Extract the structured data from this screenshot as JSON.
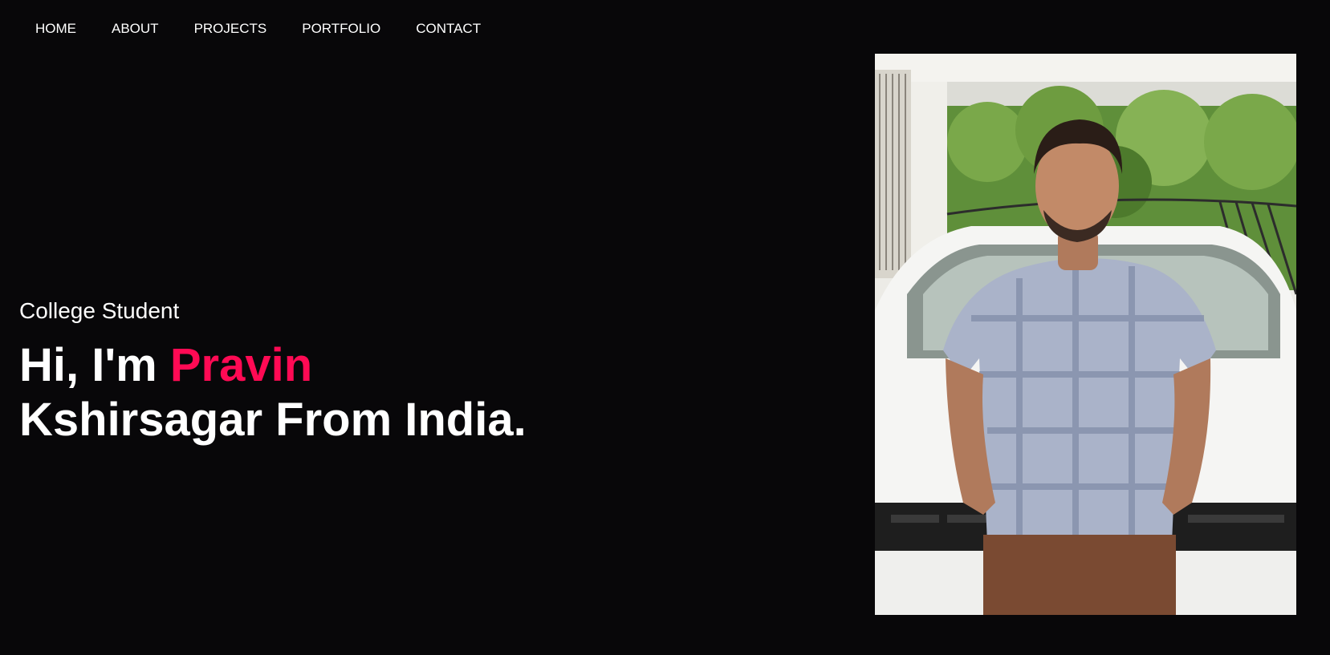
{
  "nav": {
    "items": [
      {
        "label": "HOME"
      },
      {
        "label": "ABOUT"
      },
      {
        "label": "PROJECTS"
      },
      {
        "label": "PORTFOLIO"
      },
      {
        "label": "CONTACT"
      }
    ]
  },
  "hero": {
    "subtitle": "College Student",
    "greeting": "Hi, I'm",
    "first_name": "Pravin",
    "rest": "Kshirsagar From India."
  },
  "colors": {
    "background": "#080709",
    "accent": "#ff0a54",
    "text": "#ffffff"
  }
}
